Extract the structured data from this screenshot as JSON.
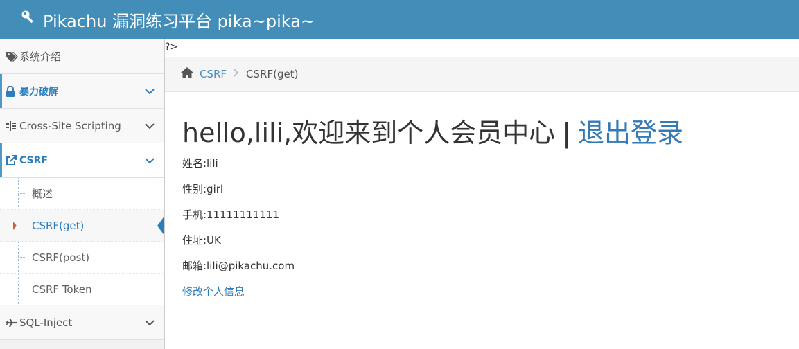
{
  "header": {
    "title": "Pikachu 漏洞练习平台 pika~pika~",
    "bg": "#438eb9"
  },
  "sidebar": {
    "items": [
      {
        "label": "系统介绍",
        "icon": "tags-icon"
      },
      {
        "label": "暴力破解",
        "icon": "lock-icon"
      },
      {
        "label": "Cross-Site Scripting",
        "icon": "indent-icon"
      },
      {
        "label": "CSRF",
        "icon": "external-link-icon"
      },
      {
        "label": "SQL-Inject",
        "icon": "plane-icon"
      }
    ],
    "csrf_sub": [
      {
        "label": "概述"
      },
      {
        "label": "CSRF(get)"
      },
      {
        "label": "CSRF(post)"
      },
      {
        "label": "CSRF Token"
      }
    ]
  },
  "main": {
    "stray_text": "?>",
    "breadcrumb": {
      "home_icon": "home-icon",
      "link": "CSRF",
      "current": "CSRF(get)"
    },
    "greeting": "hello,lili,欢迎来到个人会员中心",
    "pipe": "|",
    "logout": "退出登录",
    "fields": [
      "姓名:lili",
      "性别:girl",
      "手机:11111111111",
      "住址:UK",
      "邮箱:lili@pikachu.com"
    ],
    "edit_link": "修改个人信息"
  }
}
